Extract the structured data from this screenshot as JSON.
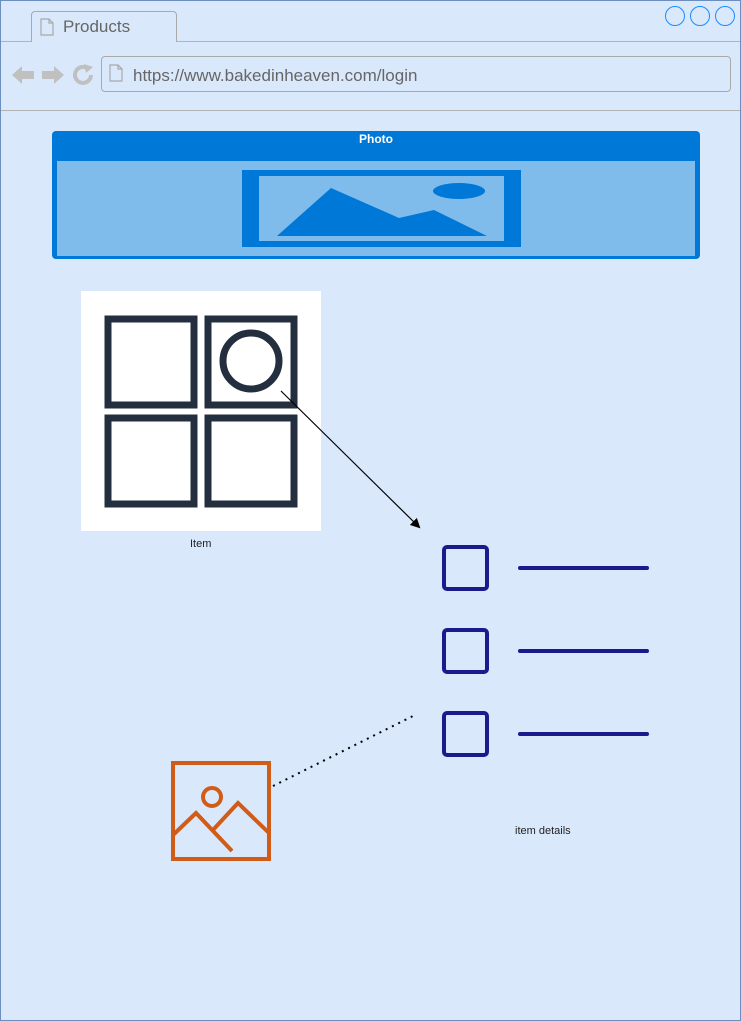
{
  "browser": {
    "tab_title": "Products",
    "url": "https://www.bakedinheaven.com/login",
    "nav_icons": [
      "back-arrow-icon",
      "forward-arrow-icon",
      "refresh-icon"
    ]
  },
  "photo_widget": {
    "title": "Photo",
    "icon": "image-placeholder-icon"
  },
  "item": {
    "caption": "Item",
    "icon": "grid-layout-icon"
  },
  "item_details": {
    "caption": "item details",
    "rows": 3,
    "icon": "checkbox-list-icon"
  },
  "image_icon": {
    "icon": "image-icon"
  },
  "colors": {
    "window_fill": "#dae8fc",
    "window_border": "#6c8ebf",
    "photo_blue": "#0078d7",
    "photo_light": "#7fbbeb",
    "grid_stroke": "#232f3e",
    "checklist_stroke": "#1a1a8c",
    "image_icon_stroke": "#d05c17"
  }
}
